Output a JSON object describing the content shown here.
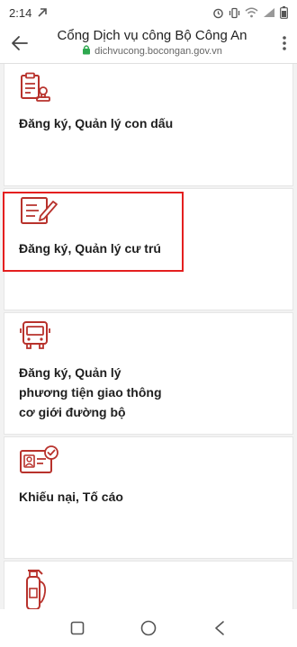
{
  "status_bar": {
    "time": "2:14",
    "icons": [
      "link-icon",
      "alarm-icon",
      "vibrate-icon",
      "wifi-icon",
      "signal-icon",
      "battery-icon"
    ]
  },
  "browser": {
    "title": "Cổng Dịch vụ công Bộ Công An",
    "url": "dichvucong.bocongan.gov.vn"
  },
  "services": [
    {
      "label": "Đăng ký, Quản lý con dấu",
      "icon": "stamp-icon"
    },
    {
      "label": "Đăng ký, Quản lý cư trú",
      "icon": "document-pen-icon"
    },
    {
      "label_lines": [
        "Đăng ký, Quản lý",
        "phương tiện giao thông",
        "cơ giới đường bộ"
      ],
      "icon": "bus-icon"
    },
    {
      "label": "Khiếu nại, Tố cáo",
      "icon": "id-card-check-icon"
    },
    {
      "label": "",
      "icon": "fire-extinguisher-icon"
    }
  ],
  "colors": {
    "accent": "#b8322c",
    "highlight": "#e41f1f",
    "secure": "#2ea84f"
  }
}
